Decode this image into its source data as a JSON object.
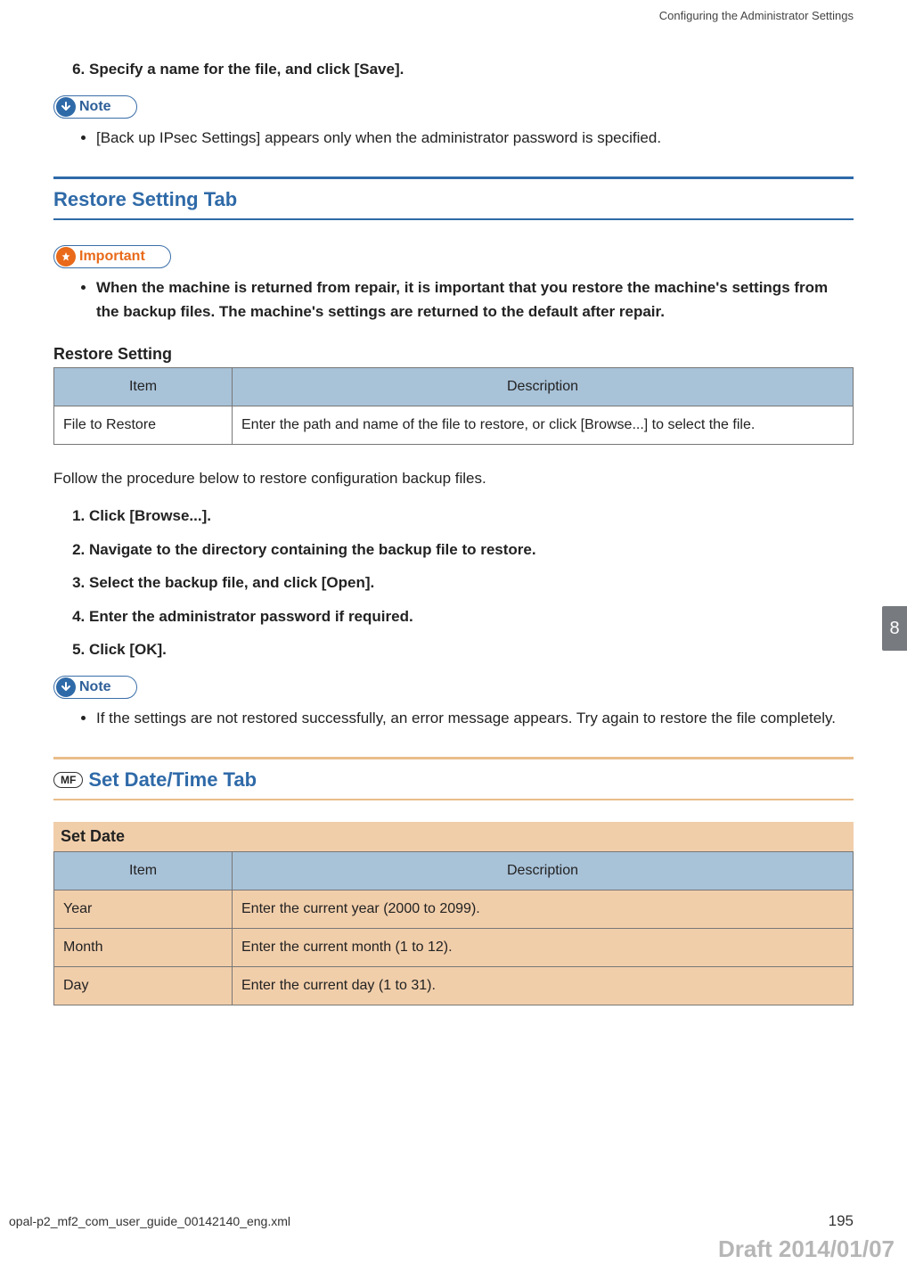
{
  "header": {
    "running_head": "Configuring the Administrator Settings"
  },
  "steps_top": {
    "start": 6,
    "items": [
      "Specify a name for the file, and click [Save]."
    ]
  },
  "note1": {
    "label": "Note",
    "bullets": [
      "[Back up IPsec Settings] appears only when the administrator password is specified."
    ]
  },
  "restore": {
    "heading": "Restore Setting Tab",
    "important_label": "Important",
    "important_bullets": [
      "When the machine is returned from repair, it is important that you restore the machine's settings from the backup files. The machine's settings are returned to the default after repair."
    ],
    "sub_heading": "Restore Setting",
    "table": {
      "head_item": "Item",
      "head_desc": "Description",
      "rows": [
        {
          "item": "File to Restore",
          "desc": "Enter the path and name of the file to restore, or click [Browse...] to select the file."
        }
      ]
    },
    "follow_text": "Follow the procedure below to restore configuration backup files.",
    "steps": [
      "Click [Browse...].",
      "Navigate to the directory containing the backup file to restore.",
      "Select the backup file, and click [Open].",
      "Enter the administrator password if required.",
      "Click [OK]."
    ],
    "note2_label": "Note",
    "note2_bullets": [
      "If the settings are not restored successfully, an error message appears. Try again to restore the file completely."
    ]
  },
  "datetime": {
    "mf": "MF",
    "heading": "Set Date/Time Tab",
    "sub_heading": "Set Date",
    "table": {
      "head_item": "Item",
      "head_desc": "Description",
      "rows": [
        {
          "item": "Year",
          "desc": "Enter the current year (2000 to 2099)."
        },
        {
          "item": "Month",
          "desc": "Enter the current month (1 to 12)."
        },
        {
          "item": "Day",
          "desc": "Enter the current day (1 to 31)."
        }
      ]
    }
  },
  "side_tab": "8",
  "footer": {
    "filename": "opal-p2_mf2_com_user_guide_00142140_eng.xml",
    "page": "195",
    "draft": "Draft 2014/01/07"
  }
}
